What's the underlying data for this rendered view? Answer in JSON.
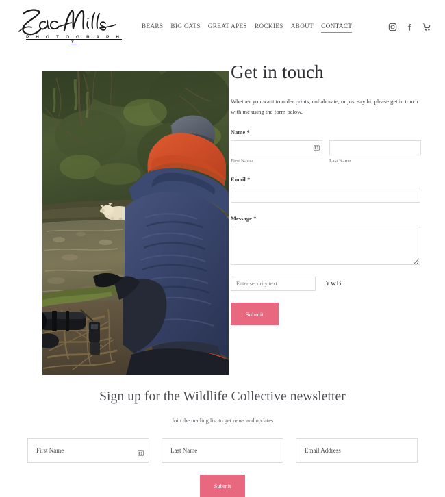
{
  "header": {
    "logo_name": "Zac Mills",
    "logo_subtitle": "P H O T O G R A P H Y",
    "nav": [
      {
        "label": "BEARS",
        "active": false
      },
      {
        "label": "BIG CATS",
        "active": false
      },
      {
        "label": "GREAT APES",
        "active": false
      },
      {
        "label": "ROCKIES",
        "active": false
      },
      {
        "label": "ABOUT",
        "active": false
      },
      {
        "label": "CONTACT",
        "active": true
      }
    ],
    "social": [
      {
        "name": "instagram-icon"
      },
      {
        "name": "facebook-icon"
      },
      {
        "name": "cart-icon"
      }
    ]
  },
  "photo": {
    "alt": "Photographer in blue jacket with red hood watching a cream-colored spirit bear across a forest stream",
    "caption": ""
  },
  "contact": {
    "title": "Get in touch",
    "description": "Whether you want to order prints, collaborate, or just say hi, please get in touch with me using the form below.",
    "name_label": "Name *",
    "first_name_value": "",
    "first_name_placeholder": "",
    "first_name_hint": "First Name",
    "last_name_value": "",
    "last_name_placeholder": "",
    "last_name_hint": "Last Name",
    "email_label": "Email *",
    "email_value": "",
    "email_placeholder": "",
    "message_label": "Message *",
    "message_value": "",
    "message_placeholder": "",
    "captcha_placeholder": "Enter security text",
    "captcha_value": "",
    "captcha_text": "YwB",
    "submit_label": "Submit"
  },
  "newsletter": {
    "title": "Sign up for the Wildlife Collective newsletter",
    "subtitle": "Join the mailing list to get news and updates",
    "first_name_placeholder": "First Name",
    "first_name_value": "",
    "last_name_placeholder": "Last Name",
    "last_name_value": "",
    "email_placeholder": "Email Address",
    "email_value": "",
    "submit_label": "Submit"
  },
  "colors": {
    "accent_pink": "#e8697f",
    "text_dark": "#2e2f33",
    "text_muted": "#55565a",
    "border_light": "#dcdcdc"
  }
}
